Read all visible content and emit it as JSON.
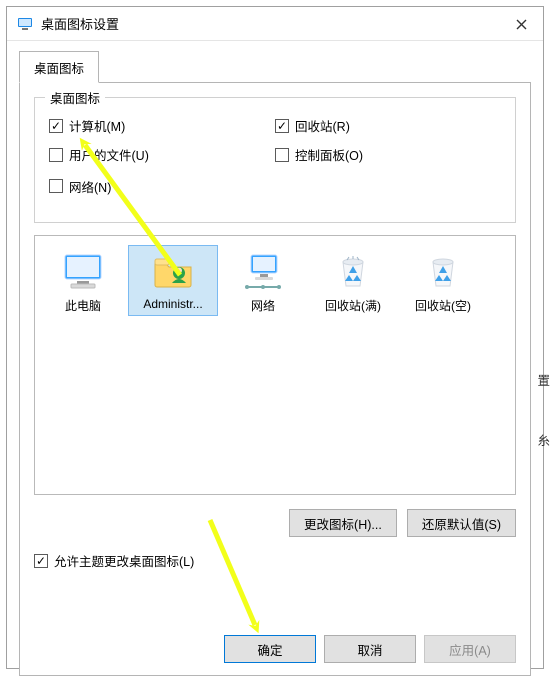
{
  "window": {
    "title": "桌面图标设置"
  },
  "tab": {
    "label": "桌面图标"
  },
  "group": {
    "legend": "桌面图标"
  },
  "checks": {
    "computer": {
      "label": "计算机(M)",
      "checked": true
    },
    "recycle": {
      "label": "回收站(R)",
      "checked": true
    },
    "userdocs": {
      "label": "用户的文件(U)",
      "checked": false
    },
    "cpanel": {
      "label": "控制面板(O)",
      "checked": false
    },
    "network": {
      "label": "网络(N)",
      "checked": false
    }
  },
  "icons": [
    {
      "id": "this-pc",
      "label": "此电脑",
      "kind": "monitor"
    },
    {
      "id": "administrator",
      "label": "Administr...",
      "kind": "user",
      "selected": true
    },
    {
      "id": "network",
      "label": "网络",
      "kind": "netmonitor"
    },
    {
      "id": "recycle-full",
      "label": "回收站(满)",
      "kind": "binfull"
    },
    {
      "id": "recycle-empty",
      "label": "回收站(空)",
      "kind": "binempty"
    }
  ],
  "buttons": {
    "change_icon": "更改图标(H)...",
    "restore_default": "还原默认值(S)"
  },
  "allow_themes": {
    "label": "允许主题更改桌面图标(L)",
    "checked": true
  },
  "footer": {
    "ok": "确定",
    "cancel": "取消",
    "apply": "应用(A)"
  },
  "edge_fragments": {
    "a": "置",
    "b": "糸"
  }
}
